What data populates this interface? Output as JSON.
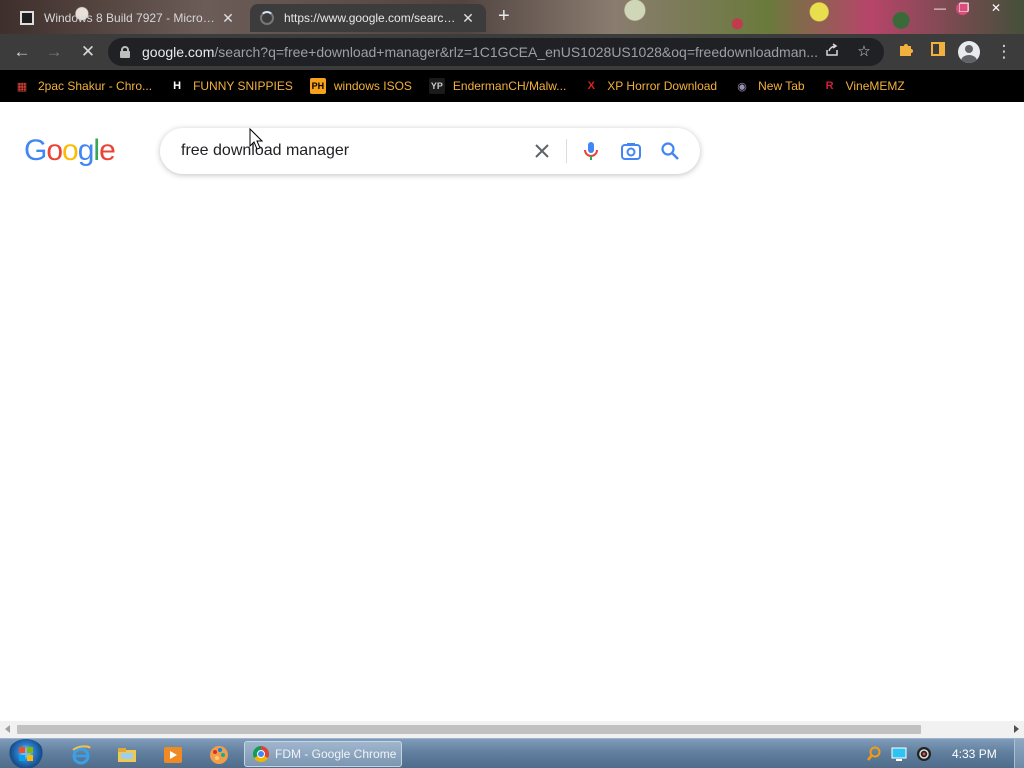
{
  "browser": {
    "tabs": [
      {
        "title": "Windows 8 Build 7927 - Microsoft",
        "active": false
      },
      {
        "title": "https://www.google.com/search?q",
        "active": true
      }
    ],
    "new_tab_symbol": "+",
    "window_controls": {
      "minimize": "—",
      "maximize": "❐",
      "close": "✕"
    },
    "address_bar": {
      "host": "google.com",
      "path": "/search?q=free+download+manager&rlz=1C1GCEA_enUS1028US1028&oq=freedownloadman..."
    },
    "nav_icons": {
      "back": "←",
      "forward": "→",
      "reload": "✕"
    },
    "bookmarks": [
      {
        "label": "2pac Shakur - Chro...",
        "icon": "ticket-icon",
        "glyph": "▦",
        "color": "#e4483a"
      },
      {
        "label": "FUNNY SNIPPIES",
        "icon": "h-icon",
        "glyph": "H",
        "color": "#ffffff"
      },
      {
        "label": "windows ISOS",
        "icon": "ph-icon",
        "glyph": "PH",
        "color": "#f7a21b"
      },
      {
        "label": "EndermanCH/Malw...",
        "icon": "yp-icon",
        "glyph": "YP",
        "color": "#1b1b1b"
      },
      {
        "label": "XP Horror Download",
        "icon": "x-icon",
        "glyph": "X",
        "color": "#e0231a"
      },
      {
        "label": "New Tab",
        "icon": "globe-icon",
        "glyph": "◉",
        "color": "#9b8fb0"
      },
      {
        "label": "VineMEMZ",
        "icon": "r-icon",
        "glyph": "R",
        "color": "#d21f3c"
      }
    ]
  },
  "google": {
    "logo_letters": [
      {
        "ch": "G",
        "color": "#4285F4"
      },
      {
        "ch": "o",
        "color": "#EA4335"
      },
      {
        "ch": "o",
        "color": "#FBBC05"
      },
      {
        "ch": "g",
        "color": "#4285F4"
      },
      {
        "ch": "l",
        "color": "#34A853"
      },
      {
        "ch": "e",
        "color": "#EA4335"
      }
    ],
    "search_query": "free download manager"
  },
  "taskbar": {
    "active_window": "FDM - Google Chrome",
    "clock": "4:33 PM"
  },
  "colors": {
    "accent_blue": "#4285F4",
    "bookmark_text": "#f2b13c",
    "toolbar_bg": "#3c3c3c"
  }
}
